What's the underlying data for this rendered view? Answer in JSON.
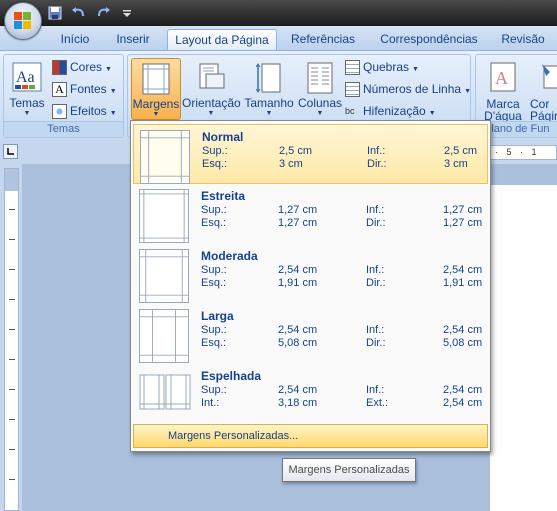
{
  "qat": {
    "icons": [
      "save-icon",
      "undo-icon",
      "redo-icon",
      "customize-icon"
    ]
  },
  "tabs": [
    "Início",
    "Inserir",
    "Layout da Página",
    "Referências",
    "Correspondências",
    "Revisão"
  ],
  "active_tab": "Layout da Página",
  "ribbon": {
    "temas": {
      "label": "Temas",
      "temas_button": "Temas",
      "cores": "Cores",
      "fontes": "Fontes",
      "efeitos": "Efeitos",
      "group_label": "Temas"
    },
    "page_setup": {
      "margens": "Margens",
      "orientacao": "Orientação",
      "tamanho": "Tamanho",
      "colunas": "Colunas",
      "quebras": "Quebras",
      "numeros_linha": "Números de Linha",
      "hifenizacao": "Hifenização"
    },
    "page_background": {
      "marca_line1": "Marca",
      "marca_line2": "D'água",
      "cor_line1": "Cor",
      "cor_line2": "Págin",
      "group_label": "Plano de Fun"
    }
  },
  "ruler": {
    "marks": "· 5 · 1"
  },
  "margins_menu": {
    "options": [
      {
        "name": "Normal",
        "r1": [
          "Sup.:",
          "2,5 cm",
          "Inf.:",
          "2,5 cm"
        ],
        "r2": [
          "Esq.:",
          "3 cm",
          "Dir.:",
          "3 cm"
        ]
      },
      {
        "name": "Estreita",
        "r1": [
          "Sup.:",
          "1,27 cm",
          "Inf.:",
          "1,27 cm"
        ],
        "r2": [
          "Esq.:",
          "1,27 cm",
          "Dir.:",
          "1,27 cm"
        ]
      },
      {
        "name": "Moderada",
        "r1": [
          "Sup.:",
          "2,54 cm",
          "Inf.:",
          "2,54 cm"
        ],
        "r2": [
          "Esq.:",
          "1,91 cm",
          "Dir.:",
          "1,91 cm"
        ]
      },
      {
        "name": "Larga",
        "r1": [
          "Sup.:",
          "2,54 cm",
          "Inf.:",
          "2,54 cm"
        ],
        "r2": [
          "Esq.:",
          "5,08 cm",
          "Dir.:",
          "5,08 cm"
        ]
      },
      {
        "name": "Espelhada",
        "r1": [
          "Sup.:",
          "2,54 cm",
          "Inf.:",
          "2,54 cm"
        ],
        "r2": [
          "Int.:",
          "3,18 cm",
          "Ext.:",
          "2,54 cm"
        ]
      }
    ],
    "custom_label": "Margens Personalizadas...",
    "tooltip": "Margens Personalizadas"
  },
  "colors": {
    "accent": "#15428b",
    "highlight": "#ffd86b",
    "ribbon": "#d4e3f6"
  }
}
